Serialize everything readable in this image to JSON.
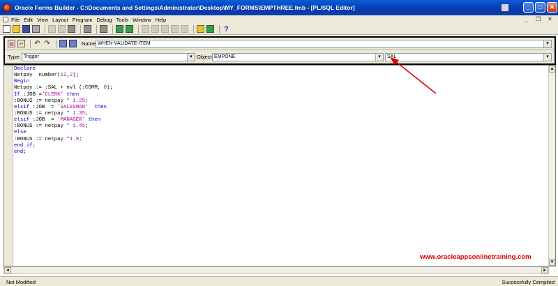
{
  "window": {
    "title": "Oracle Forms Builder - C:\\Documents and Settings\\Administrator\\Desktop\\MY_FORMS\\EMPTHREE.fmb - [PL/SQL Editor]",
    "minimize": "_",
    "maximize": "□",
    "close": "✕"
  },
  "menu": {
    "items": [
      "File",
      "Edit",
      "View",
      "Layout",
      "Program",
      "Debug",
      "Tools",
      "Window",
      "Help"
    ],
    "mdi_minimize": "_",
    "mdi_restore": "❐",
    "mdi_close": "✕"
  },
  "editor": {
    "name_label": "Name:",
    "name_value": "WHEN-VALIDATE-ITEM",
    "type_label": "Type:",
    "type_value": "Trigger",
    "object_label": "Object:",
    "object_value": "EMPONE",
    "item_value": "SAL",
    "dropdown_glyph": "▾"
  },
  "code": {
    "lines": [
      "Declare",
      "Netpay  number(12,2);",
      "Begin",
      "Netpay := :SAL + nvl (:COMM, 0);",
      "If :JOB ='CLERK' then",
      ":BONUS := netpay * 1.25;",
      "elsif :JOB  = 'SALESMAN'  then",
      ":BONUS := netpay * 1.35;",
      "elsif :JOB  = 'MANAGER' then",
      ":BONUS := netpay * 1.45;",
      "else",
      ":BONUS := netpay *1.9;",
      "end if;",
      "end;"
    ]
  },
  "watermark": "www.oracleappsonlinetraining.com",
  "status": {
    "left": "Not Modified",
    "right": "Successfully Compiled"
  },
  "colors": {
    "titlebar": "#0a3aa7",
    "keyword": "#0000c8",
    "string": "#b000b0",
    "annotation": "#e00000"
  }
}
